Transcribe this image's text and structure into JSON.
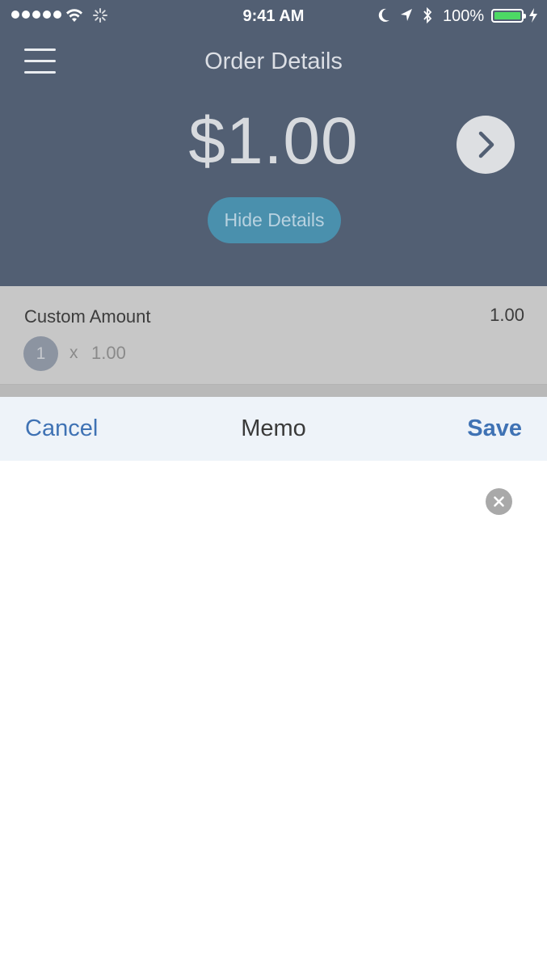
{
  "status_bar": {
    "time": "9:41 AM",
    "battery_percent": "100%",
    "battery_level": 1.0
  },
  "header": {
    "title": "Order Details",
    "amount": "$1.00",
    "hide_details_label": "Hide Details"
  },
  "order_item": {
    "name": "Custom Amount",
    "price": "1.00",
    "quantity": "1",
    "times": "x",
    "unit_price": "1.00"
  },
  "memo": {
    "cancel_label": "Cancel",
    "title": "Memo",
    "save_label": "Save",
    "value": ""
  },
  "colors": {
    "header_bg": "#525f73",
    "accent_blue": "#3f72b4",
    "hide_details_bg": "#4a90ad",
    "battery_fill": "#4cd964"
  },
  "icons": [
    "signal-dots-icon",
    "wifi-icon",
    "activity-spinner-icon",
    "moon-icon",
    "location-arrow-icon",
    "bluetooth-icon",
    "battery-icon",
    "charging-bolt-icon",
    "hamburger-menu-icon",
    "chevron-right-icon",
    "clear-x-icon"
  ]
}
